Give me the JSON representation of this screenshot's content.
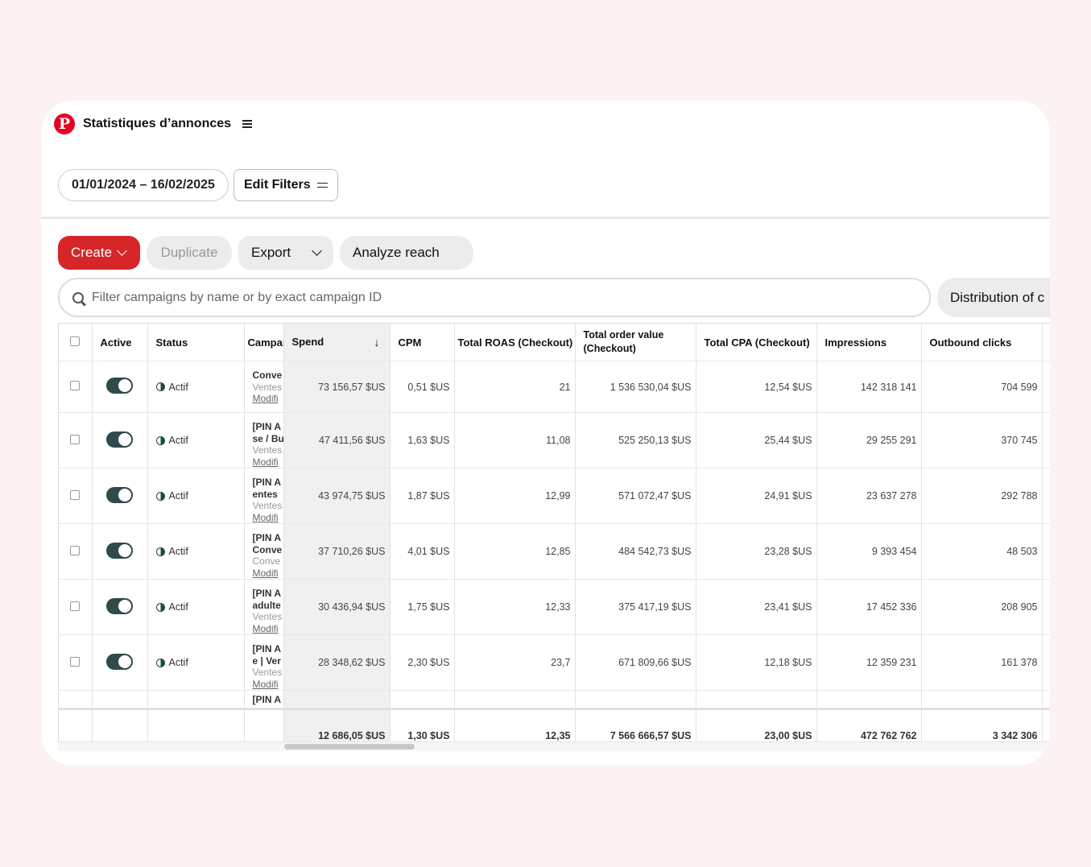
{
  "app": {
    "title": "Statistiques d’annonces",
    "logo_glyph": "P",
    "brand_color": "#e60023"
  },
  "filters": {
    "date_range": "01/01/2024 – 16/02/2025",
    "edit_filters_label": "Edit Filters"
  },
  "actions": {
    "create": "Create",
    "duplicate": "Duplicate",
    "export": "Export",
    "analyze_reach": "Analyze reach"
  },
  "search": {
    "placeholder": "Filter campaigns by name or by exact campaign ID"
  },
  "distribution_label": "Distribution of c",
  "columns": {
    "active": "Active",
    "status": "Status",
    "campaign": "Campai",
    "spend": "Spend",
    "cpm": "CPM",
    "roas": "Total ROAS (Checkout)",
    "order_value": "Total order value (Checkout)",
    "cpa": "Total CPA (Checkout)",
    "impressions": "Impressions",
    "outbound": "Outbound clicks"
  },
  "rows": [
    {
      "status": "Actif",
      "campaign": [
        "Conve",
        "Ventes",
        "Modifi"
      ],
      "spend": "73 156,57 $US",
      "cpm": "0,51 $US",
      "roas": "21",
      "order_value": "1 536 530,04 $US",
      "cpa": "12,54 $US",
      "impressions": "142 318 141",
      "outbound": "704 599"
    },
    {
      "status": "Actif",
      "campaign": [
        "[PIN A",
        "se / Bu",
        "Ventes",
        "Modifi"
      ],
      "spend": "47 411,56 $US",
      "cpm": "1,63 $US",
      "roas": "11,08",
      "order_value": "525 250,13 $US",
      "cpa": "25,44 $US",
      "impressions": "29 255 291",
      "outbound": "370 745"
    },
    {
      "status": "Actif",
      "campaign": [
        "[PIN A",
        "entes",
        "Ventes",
        "Modifi"
      ],
      "spend": "43 974,75 $US",
      "cpm": "1,87 $US",
      "roas": "12,99",
      "order_value": "571 072,47 $US",
      "cpa": "24,91 $US",
      "impressions": "23 637 278",
      "outbound": "292 788"
    },
    {
      "status": "Actif",
      "campaign": [
        "[PIN A",
        "Conve",
        "Conve",
        "Modifi"
      ],
      "spend": "37 710,26 $US",
      "cpm": "4,01 $US",
      "roas": "12,85",
      "order_value": "484 542,73 $US",
      "cpa": "23,28 $US",
      "impressions": "9 393 454",
      "outbound": "48 503"
    },
    {
      "status": "Actif",
      "campaign": [
        "[PIN A",
        "adulte",
        "Ventes",
        "Modifi"
      ],
      "spend": "30 436,94 $US",
      "cpm": "1,75 $US",
      "roas": "12,33",
      "order_value": "375 417,19 $US",
      "cpa": "23,41 $US",
      "impressions": "17 452 336",
      "outbound": "208 905"
    },
    {
      "status": "Actif",
      "campaign": [
        "[PIN A",
        "e | Ver",
        "Ventes",
        "Modifi"
      ],
      "spend": "28 348,62 $US",
      "cpm": "2,30 $US",
      "roas": "23,7",
      "order_value": "671 809,66 $US",
      "cpa": "12,18 $US",
      "impressions": "12 359 231",
      "outbound": "161 378"
    }
  ],
  "partial_row_campaign": "[PIN A",
  "totals": {
    "spend": "12 686,05 $US",
    "cpm": "1,30 $US",
    "roas": "12,35",
    "order_value": "7 566 666,57 $US",
    "cpa": "23,00 $US",
    "impressions": "472 762 762",
    "outbound": "3 342 306"
  }
}
